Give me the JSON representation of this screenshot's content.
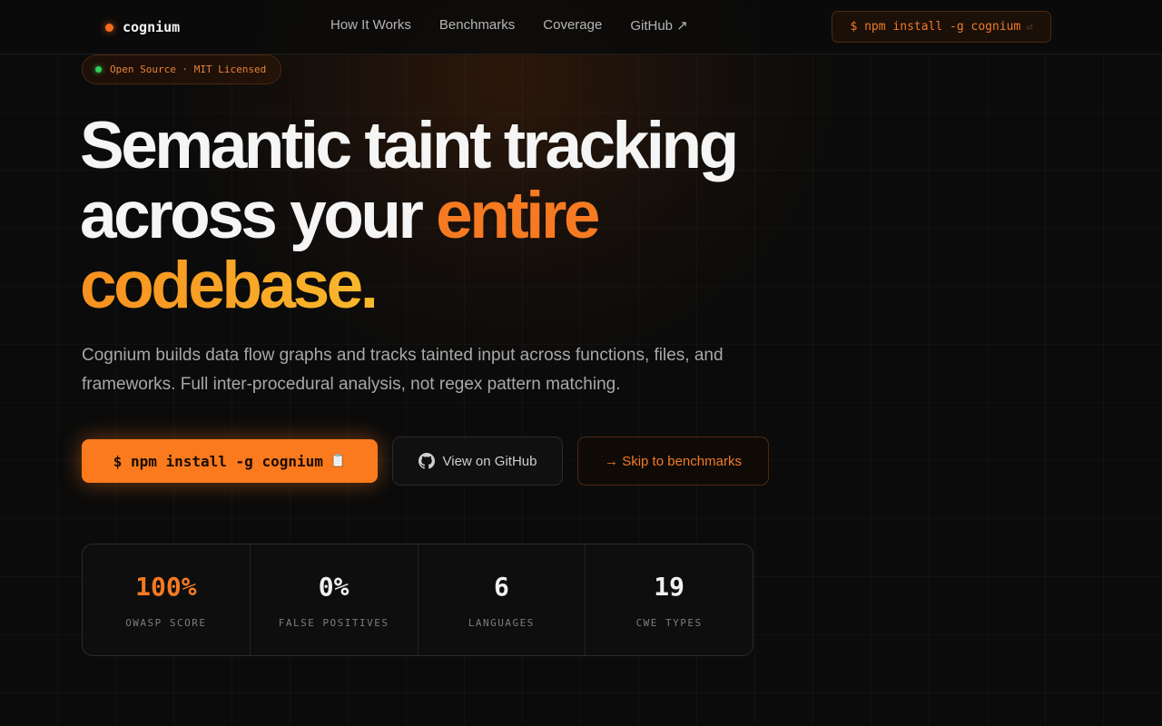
{
  "nav": {
    "brand": "cognium",
    "links": [
      "How It Works",
      "Benchmarks",
      "Coverage",
      "GitHub ↗"
    ],
    "cta": "$ npm install -g cognium",
    "cta_icon": "⏎"
  },
  "badge": "Open Source · MIT Licensed",
  "headline": {
    "line1": "Semantic taint tracking",
    "line2_plain": "across your ",
    "line2_accent": "entire",
    "line3": "codebase."
  },
  "subtext": "Cognium builds data flow graphs and tracks tainted input across functions, files, and frameworks. Full inter-procedural analysis, not regex pattern matching.",
  "buttons": {
    "install": "$ npm install -g cognium",
    "install_icon": "📋",
    "github": "View on GitHub",
    "skip": "→ Skip to benchmarks"
  },
  "stats": [
    {
      "value": "100%",
      "label": "OWASP SCORE"
    },
    {
      "value": "0%",
      "label": "FALSE POSITIVES"
    },
    {
      "value": "6",
      "label": "LANGUAGES"
    },
    {
      "value": "19",
      "label": "CWE TYPES"
    }
  ],
  "colors": {
    "accent": "#f57a22",
    "accent_gradient_end": "#f8b92c",
    "background": "#0b0b0b",
    "badge_dot": "#2fd158"
  }
}
